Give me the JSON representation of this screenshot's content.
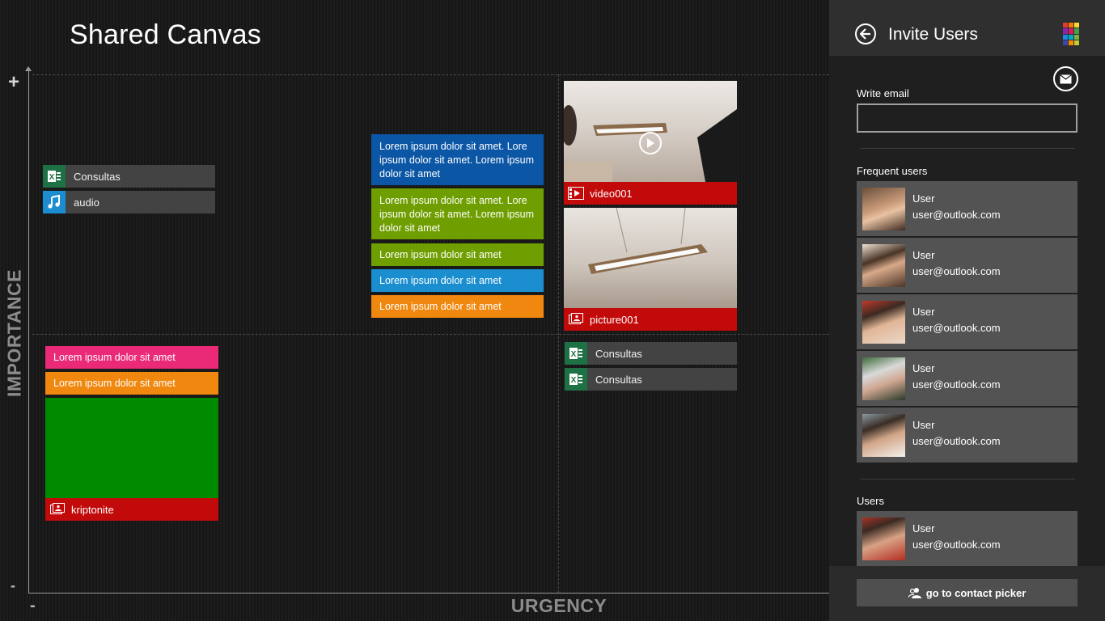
{
  "app": {
    "title": "Shared Canvas"
  },
  "axes": {
    "y_label": "IMPORTANCE",
    "x_label": "URGENCY",
    "plus": "+",
    "minus_y": "-",
    "minus_x": "-"
  },
  "files": [
    {
      "name": "Consultas",
      "icon": "excel-icon"
    },
    {
      "name": "audio",
      "icon": "music-note-icon"
    },
    {
      "name": "Consultas",
      "icon": "excel-icon"
    },
    {
      "name": "Consultas",
      "icon": "excel-icon"
    }
  ],
  "notes": [
    {
      "text": "Lorem ipsum dolor sit amet. Lore ipsum dolor sit amet. Lorem ipsum dolor sit amet",
      "color": "#0b56a5"
    },
    {
      "text": "Lorem ipsum dolor sit amet. Lore ipsum dolor sit amet. Lorem ipsum dolor sit amet",
      "color": "#6f9e00"
    },
    {
      "text": "Lorem ipsum dolor sit amet",
      "color": "#6f9e00"
    },
    {
      "text": "Lorem ipsum dolor sit amet",
      "color": "#1b8ecf"
    },
    {
      "text": "Lorem ipsum dolor sit amet",
      "color": "#f0870e"
    },
    {
      "text": "Lorem ipsum dolor sit amet",
      "color": "#ea2a76"
    },
    {
      "text": "Lorem ipsum dolor sit amet",
      "color": "#f0870e"
    }
  ],
  "media": [
    {
      "caption": "video001",
      "icon": "video-icon"
    },
    {
      "caption": "picture001",
      "icon": "picture-icon"
    },
    {
      "caption": "kriptonite",
      "icon": "picture-icon"
    }
  ],
  "panel": {
    "title": "Invite Users",
    "email_label": "Write email",
    "email_value": "",
    "frequent_label": "Frequent users",
    "users_label": "Users",
    "picker_label": "go to contact picker"
  },
  "frequent_users": [
    {
      "name": "User",
      "email": "user@outlook.com"
    },
    {
      "name": "User",
      "email": "user@outlook.com"
    },
    {
      "name": "User",
      "email": "user@outlook.com"
    },
    {
      "name": "User",
      "email": "user@outlook.com"
    },
    {
      "name": "User",
      "email": "user@outlook.com"
    }
  ],
  "users": [
    {
      "name": "User",
      "email": "user@outlook.com"
    }
  ],
  "colors": {
    "excel": "#1e7145",
    "audio": "#1d8dd2",
    "media_caption": "#c20a0a",
    "kriptonite_fill": "#008a00",
    "user_card": "#535353"
  }
}
